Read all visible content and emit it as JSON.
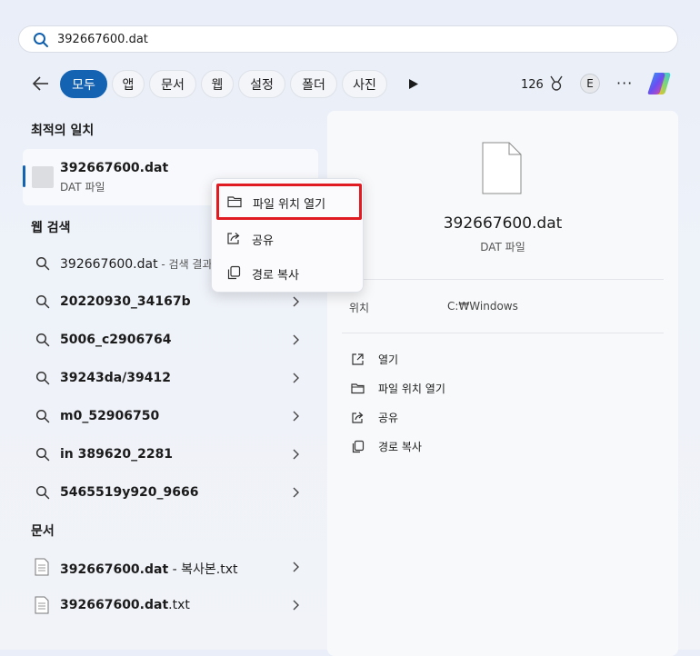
{
  "search": {
    "value": "392667600.dat"
  },
  "filters": {
    "items": [
      {
        "label": "모두",
        "active": true
      },
      {
        "label": "앱"
      },
      {
        "label": "문서"
      },
      {
        "label": "웹"
      },
      {
        "label": "설정"
      },
      {
        "label": "폴더"
      },
      {
        "label": "사진"
      }
    ],
    "points": "126",
    "avatar_initial": "E",
    "more": "···"
  },
  "best_match": {
    "title": "최적의 일치",
    "name": "392667600.dat",
    "type": "DAT 파일"
  },
  "web_search": {
    "title": "웹 검색",
    "items": [
      {
        "text": "392667600.dat",
        "suffix": " - 검색 결과 보"
      },
      {
        "text": "20220930_34167b"
      },
      {
        "text": "5006_c2906764"
      },
      {
        "text": "39243da/39412"
      },
      {
        "text": "m0_52906750"
      },
      {
        "text": "in 389620_2281"
      },
      {
        "text": "5465519y920_9666"
      }
    ]
  },
  "documents": {
    "title": "문서",
    "items": [
      {
        "text": "392667600.dat",
        "suffix": " - 복사본.txt"
      },
      {
        "text": "392667600.dat",
        "suffix": ".txt"
      }
    ]
  },
  "context_menu": {
    "open_location": "파일 위치 열기",
    "share": "공유",
    "copy_path": "경로 복사"
  },
  "preview": {
    "name": "392667600.dat",
    "type": "DAT 파일",
    "location_label": "위치",
    "location_value": "C:₩Windows",
    "actions": {
      "open": "열기",
      "open_location": "파일 위치 열기",
      "share": "공유",
      "copy_path": "경로 복사"
    }
  },
  "colors": {
    "accent": "#1463b3",
    "highlight": "#e11b22"
  }
}
